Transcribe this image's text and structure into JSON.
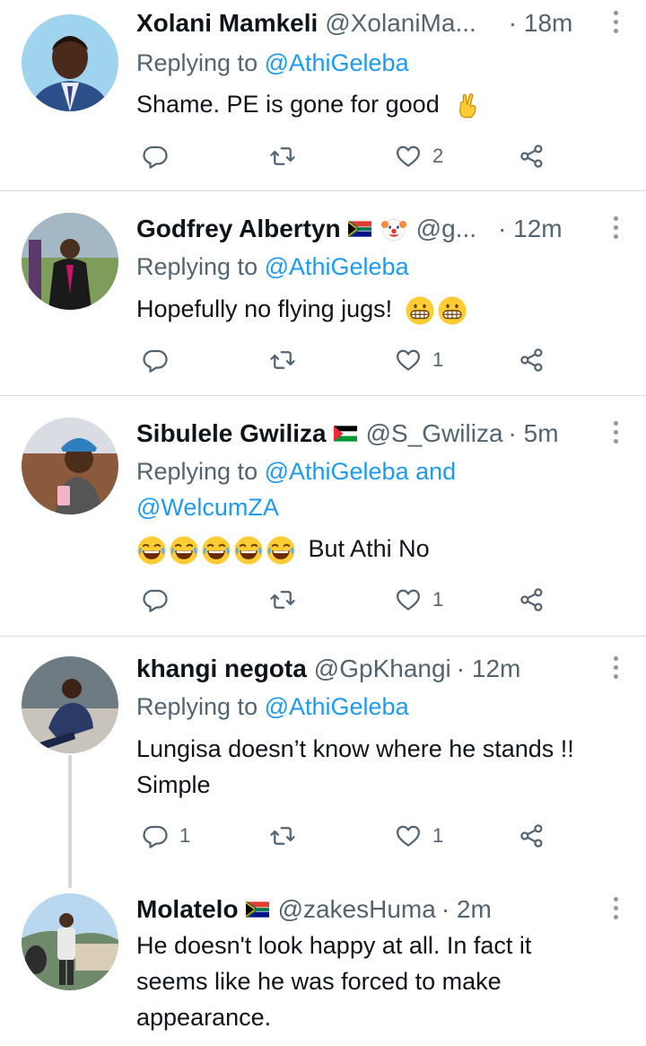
{
  "tweets": [
    {
      "name": "Xolani Mamkeli",
      "handle": "@XolaniMa...",
      "time": "· 18m",
      "reply_prefix": "Replying to ",
      "reply_mentions": "@AthiGeleba",
      "text": "Shame. PE is gone for good",
      "replies": "",
      "retweets": "",
      "likes": "2"
    },
    {
      "name": "Godfrey Albertyn",
      "handle": "@g...",
      "time": "· 12m",
      "reply_prefix": "Replying to ",
      "reply_mentions": "@AthiGeleba",
      "text": "Hopefully no flying jugs!",
      "replies": "",
      "retweets": "",
      "likes": "1"
    },
    {
      "name": "Sibulele Gwiliza",
      "handle": "@S_Gwiliza",
      "time": "· 5m",
      "reply_prefix": "Replying to ",
      "reply_mentions": "@AthiGeleba and",
      "reply_mentions_2": "@WelcumZA",
      "text": "But Athi No",
      "replies": "",
      "retweets": "",
      "likes": "1"
    },
    {
      "name": "khangi negota",
      "handle": "@GpKhangi",
      "time": "· 12m",
      "reply_prefix": "Replying to ",
      "reply_mentions": "@AthiGeleba",
      "text_line1": "Lungisa doesn’t know where he stands !!",
      "text_line2": "Simple",
      "replies": "1",
      "retweets": "",
      "likes": "1"
    },
    {
      "name": "Molatelo",
      "handle": "@zakesHuma",
      "time": "· 2m",
      "text_line1": "He doesn't look happy at all. In fact it",
      "text_line2": "seems like he was forced to make",
      "text_line3": "appearance."
    }
  ],
  "icons": {
    "reply": "reply-icon",
    "retweet": "retweet-icon",
    "like": "heart-icon",
    "share": "share-icon"
  },
  "colors": {
    "mention": "#1d9bf0",
    "secondary_text": "#536471",
    "divider": "#d8dde1"
  }
}
